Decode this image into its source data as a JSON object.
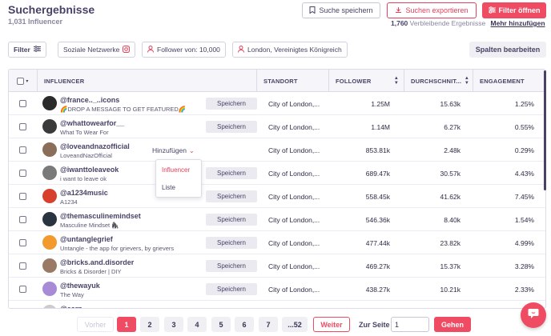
{
  "header": {
    "title": "Suchergebnisse",
    "subtitle": "1,031 Influencer",
    "save_search": "Suche speichern",
    "export_search": "Suchen exportieren",
    "open_filter": "Filter öffnen",
    "remaining_count": "1,760",
    "remaining_label": "Verbleibende Ergebnisse",
    "add_more": "Mehr hinzufügen"
  },
  "filters": {
    "filter_label": "Filter",
    "chips": [
      "Soziale Netzwerke",
      "Follower von: 10,000",
      "London, Vereinigtes Königreich"
    ],
    "edit_columns": "Spalten bearbeiten"
  },
  "table": {
    "columns": [
      "INFLUENCER",
      "STANDORT",
      "FOLLOWER",
      "DURCHSCHNIT...",
      "ENGAGEMENT"
    ],
    "save_label": "Speichern",
    "add_label": "Hinzufügen",
    "rows": [
      {
        "handle": "@france.._..icons",
        "name": "🌈DROP A MESSAGE TO GET FEATURED🌈",
        "location": "City of London,...",
        "followers": "1.25M",
        "avg": "15.63k",
        "engagement": "1.25%",
        "avatar_color": "#2b2b2b"
      },
      {
        "handle": "@whattowearfor__",
        "name": "What To Wear For",
        "location": "City of London,...",
        "followers": "1.14M",
        "avg": "6.27k",
        "engagement": "0.55%",
        "avatar_color": "#3a3a3a"
      },
      {
        "handle": "@loveandnazofficial",
        "name": "LoveandNazOfficial",
        "location": "City of London,...",
        "followers": "853.81k",
        "avg": "2.48k",
        "engagement": "0.29%",
        "avatar_color": "#8a6e5a"
      },
      {
        "handle": "@iwanttoleaveok",
        "name": "i want to leave ok",
        "location": "City of London,...",
        "followers": "689.47k",
        "avg": "30.57k",
        "engagement": "4.43%",
        "avatar_color": "#7a7a7a"
      },
      {
        "handle": "@a1234music",
        "name": "A1234",
        "location": "City of London,...",
        "followers": "558.45k",
        "avg": "41.62k",
        "engagement": "7.45%",
        "avatar_color": "#d8402e"
      },
      {
        "handle": "@themasculinemindset",
        "name": "Masculine Mindset 🦍",
        "location": "City of London,...",
        "followers": "546.36k",
        "avg": "8.40k",
        "engagement": "1.54%",
        "avatar_color": "#2a3440"
      },
      {
        "handle": "@untanglegrief",
        "name": "Untangle - the app for grievers, by grievers",
        "location": "City of London,...",
        "followers": "477.44k",
        "avg": "23.82k",
        "engagement": "4.99%",
        "avatar_color": "#f29a2e"
      },
      {
        "handle": "@bricks.and.disorder",
        "name": "Bricks & Disorder | DIY",
        "location": "City of London,...",
        "followers": "469.27k",
        "avg": "15.37k",
        "engagement": "3.28%",
        "avatar_color": "#9a7a66"
      },
      {
        "handle": "@thewayuk",
        "name": "The Way",
        "location": "City of London,...",
        "followers": "438.27k",
        "avg": "10.21k",
        "engagement": "2.33%",
        "avatar_color": "#a78bd6"
      },
      {
        "handle": "@earn",
        "name": "",
        "location": "",
        "followers": "",
        "avg": "",
        "engagement": "",
        "avatar_color": "#cccccc"
      }
    ]
  },
  "dropdown": {
    "options": [
      "Influencer",
      "Liste"
    ]
  },
  "pagination": {
    "prev": "Vorher",
    "pages": [
      "1",
      "2",
      "3",
      "4",
      "5",
      "6",
      "7",
      "...52"
    ],
    "next": "Weiter",
    "goto_label": "Zur Seite",
    "goto_value": "1",
    "go": "Gehen"
  },
  "colors": {
    "accent": "#ef4b63",
    "text": "#4a4266"
  }
}
